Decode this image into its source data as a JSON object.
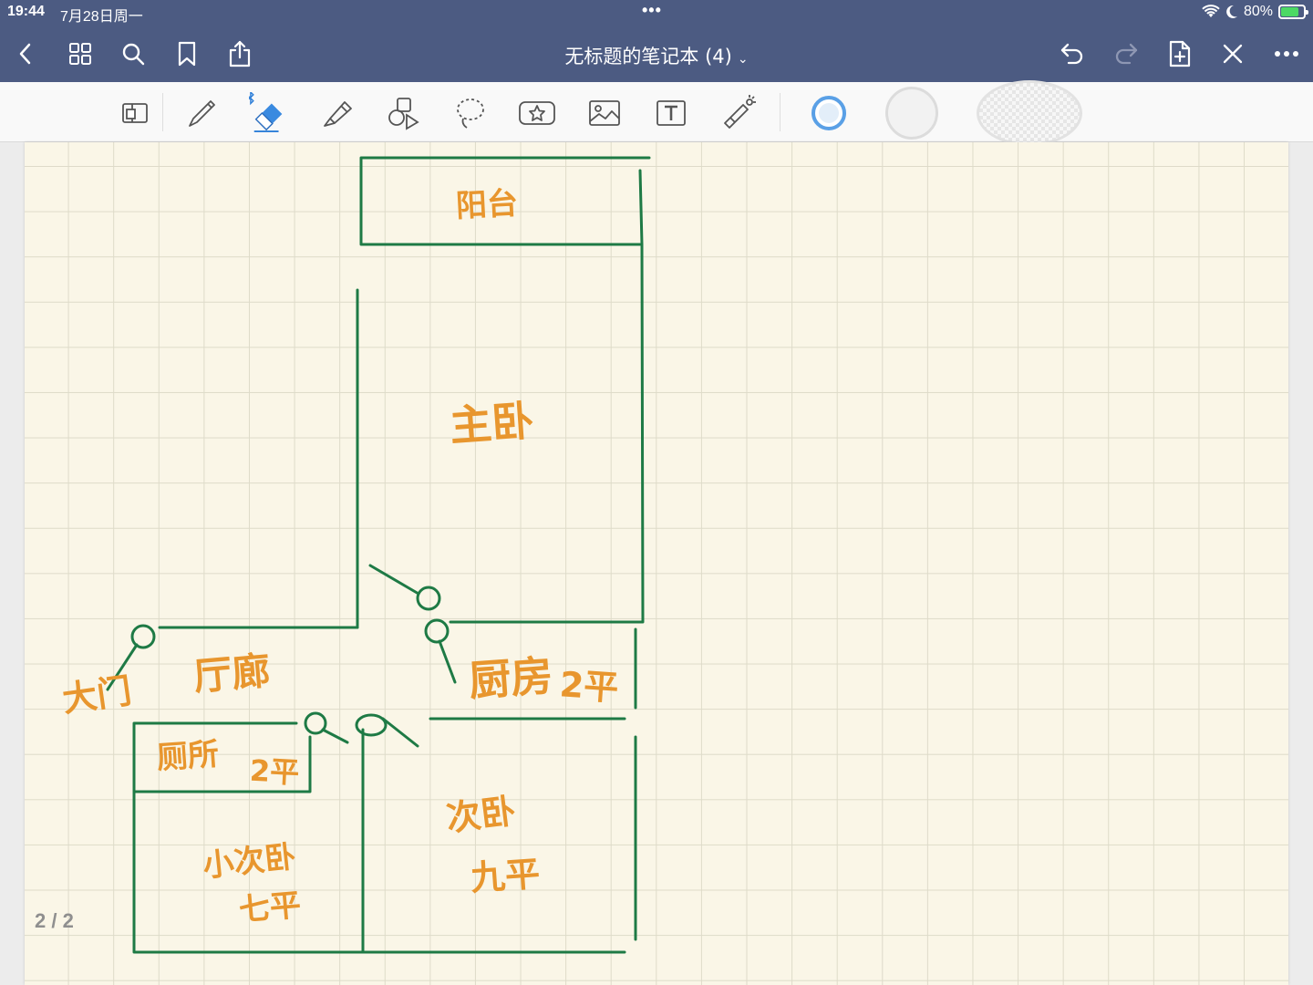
{
  "status_bar": {
    "time": "19:44",
    "date": "7月28日周一",
    "dots": "•••",
    "battery_text": "80%",
    "battery_level": 0.8
  },
  "nav": {
    "title": "无标题的笔记本 (4)",
    "title_chevron": "⌄",
    "left_icons": [
      "back-icon",
      "grid-icon",
      "search-icon",
      "bookmark-icon",
      "share-icon"
    ],
    "right_icons": [
      "undo-icon",
      "redo-icon",
      "add-page-icon",
      "close-icon",
      "more-icon"
    ]
  },
  "toolbar": {
    "tools": [
      "sidebar-toggle-icon",
      "pen-icon",
      "eraser-icon",
      "highlighter-icon",
      "shapes-icon",
      "lasso-icon",
      "sticker-icon",
      "image-icon",
      "text-icon",
      "laser-pointer-icon"
    ],
    "active_tool": "eraser-icon",
    "colors": [
      "#5aa0e6",
      "#f2f2f2",
      "#eeeeee"
    ]
  },
  "page": {
    "indicator": "2 / 2",
    "ink_green": "#1e7a45",
    "ink_orange": "#e8962e",
    "labels": {
      "balcony": "阳台",
      "master_bedroom": "主卧",
      "hallway": "厅廊",
      "main_door": "大门",
      "kitchen": "厨房",
      "kitchen_area": "2平",
      "toilet": "厕所",
      "toilet_area": "2平",
      "small_bedroom": "小次卧",
      "small_bedroom_area": "七平",
      "second_bedroom": "次卧",
      "second_bedroom_area": "九平"
    }
  }
}
